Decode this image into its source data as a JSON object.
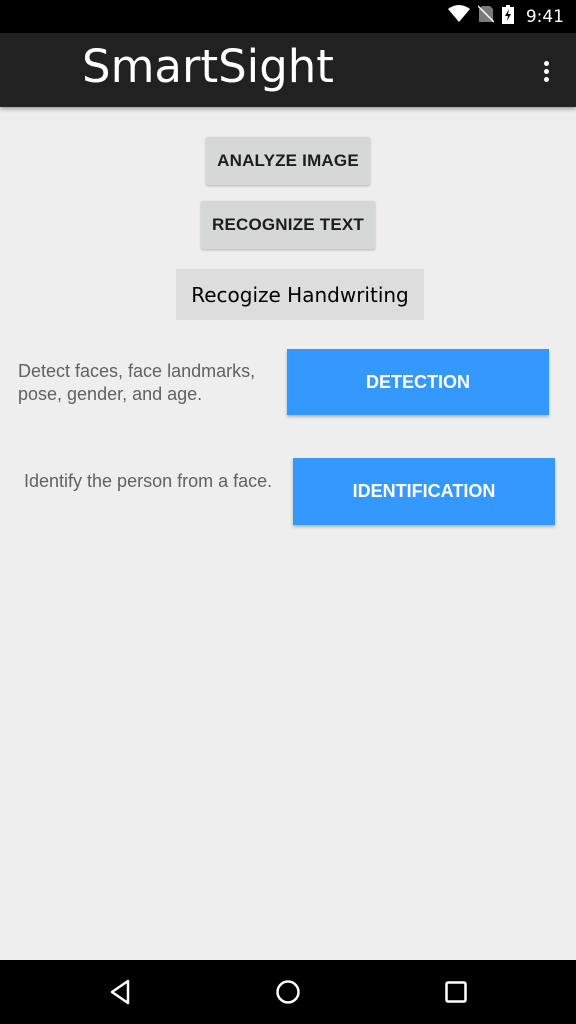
{
  "status_bar": {
    "time": "9:41",
    "icons": [
      "wifi-icon",
      "no-sim-icon",
      "battery-charging-icon"
    ]
  },
  "app_bar": {
    "title": "SmartSight",
    "menu_icon": "overflow-menu-icon"
  },
  "buttons": {
    "analyze_image": "ANALYZE IMAGE",
    "recognize_text": "RECOGNIZE TEXT",
    "recognize_handwriting": "Recogize Handwriting"
  },
  "face_features": [
    {
      "description": "Detect faces, face landmarks, pose, gender, and age.",
      "button_label": "DETECTION"
    },
    {
      "description": "Identify the person from a face.",
      "button_label": "IDENTIFICATION"
    }
  ],
  "nav_bar": {
    "buttons": [
      "back-icon",
      "home-icon",
      "recent-apps-icon"
    ]
  },
  "colors": {
    "accent_blue": "#3399ff",
    "app_bar": "#212121",
    "background": "#eeeeee"
  }
}
